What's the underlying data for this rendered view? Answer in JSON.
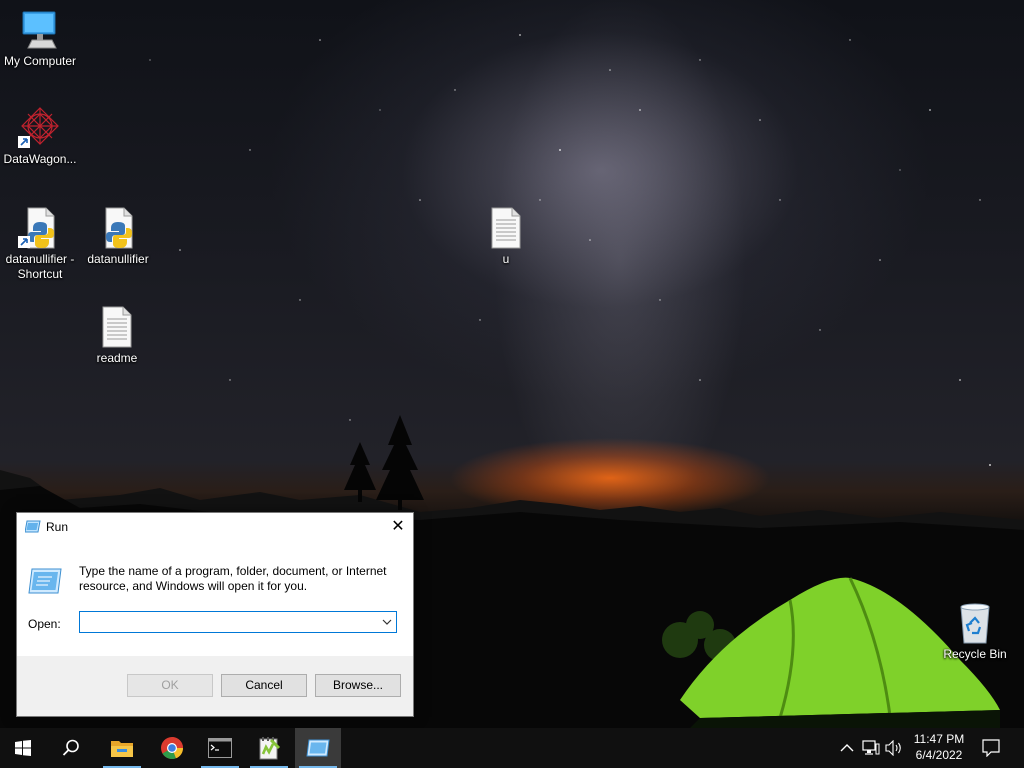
{
  "desktop": {
    "icons": [
      {
        "label": "My Computer"
      },
      {
        "label": "DataWagon..."
      },
      {
        "label": "datanullifier - Shortcut"
      },
      {
        "label": "datanullifier"
      },
      {
        "label": "u"
      },
      {
        "label": "readme"
      },
      {
        "label": "Recycle Bin"
      }
    ]
  },
  "run_dialog": {
    "title": "Run",
    "close_glyph": "✕",
    "description": "Type the name of a program, folder, document, or Internet resource, and Windows will open it for you.",
    "open_label": "Open:",
    "open_value": "",
    "ok_label": "OK",
    "cancel_label": "Cancel",
    "browse_label": "Browse..."
  },
  "taskbar": {
    "items": [
      "windows-start-icon",
      "search-icon",
      "file-explorer-icon",
      "chrome-icon",
      "command-prompt-icon",
      "notepad-plus-icon",
      "run-icon"
    ],
    "time": "11:47 PM",
    "date": "6/4/2022"
  },
  "colors": {
    "accent": "#0078d7",
    "taskbar": "#101010",
    "tent": "#7fd12a"
  }
}
